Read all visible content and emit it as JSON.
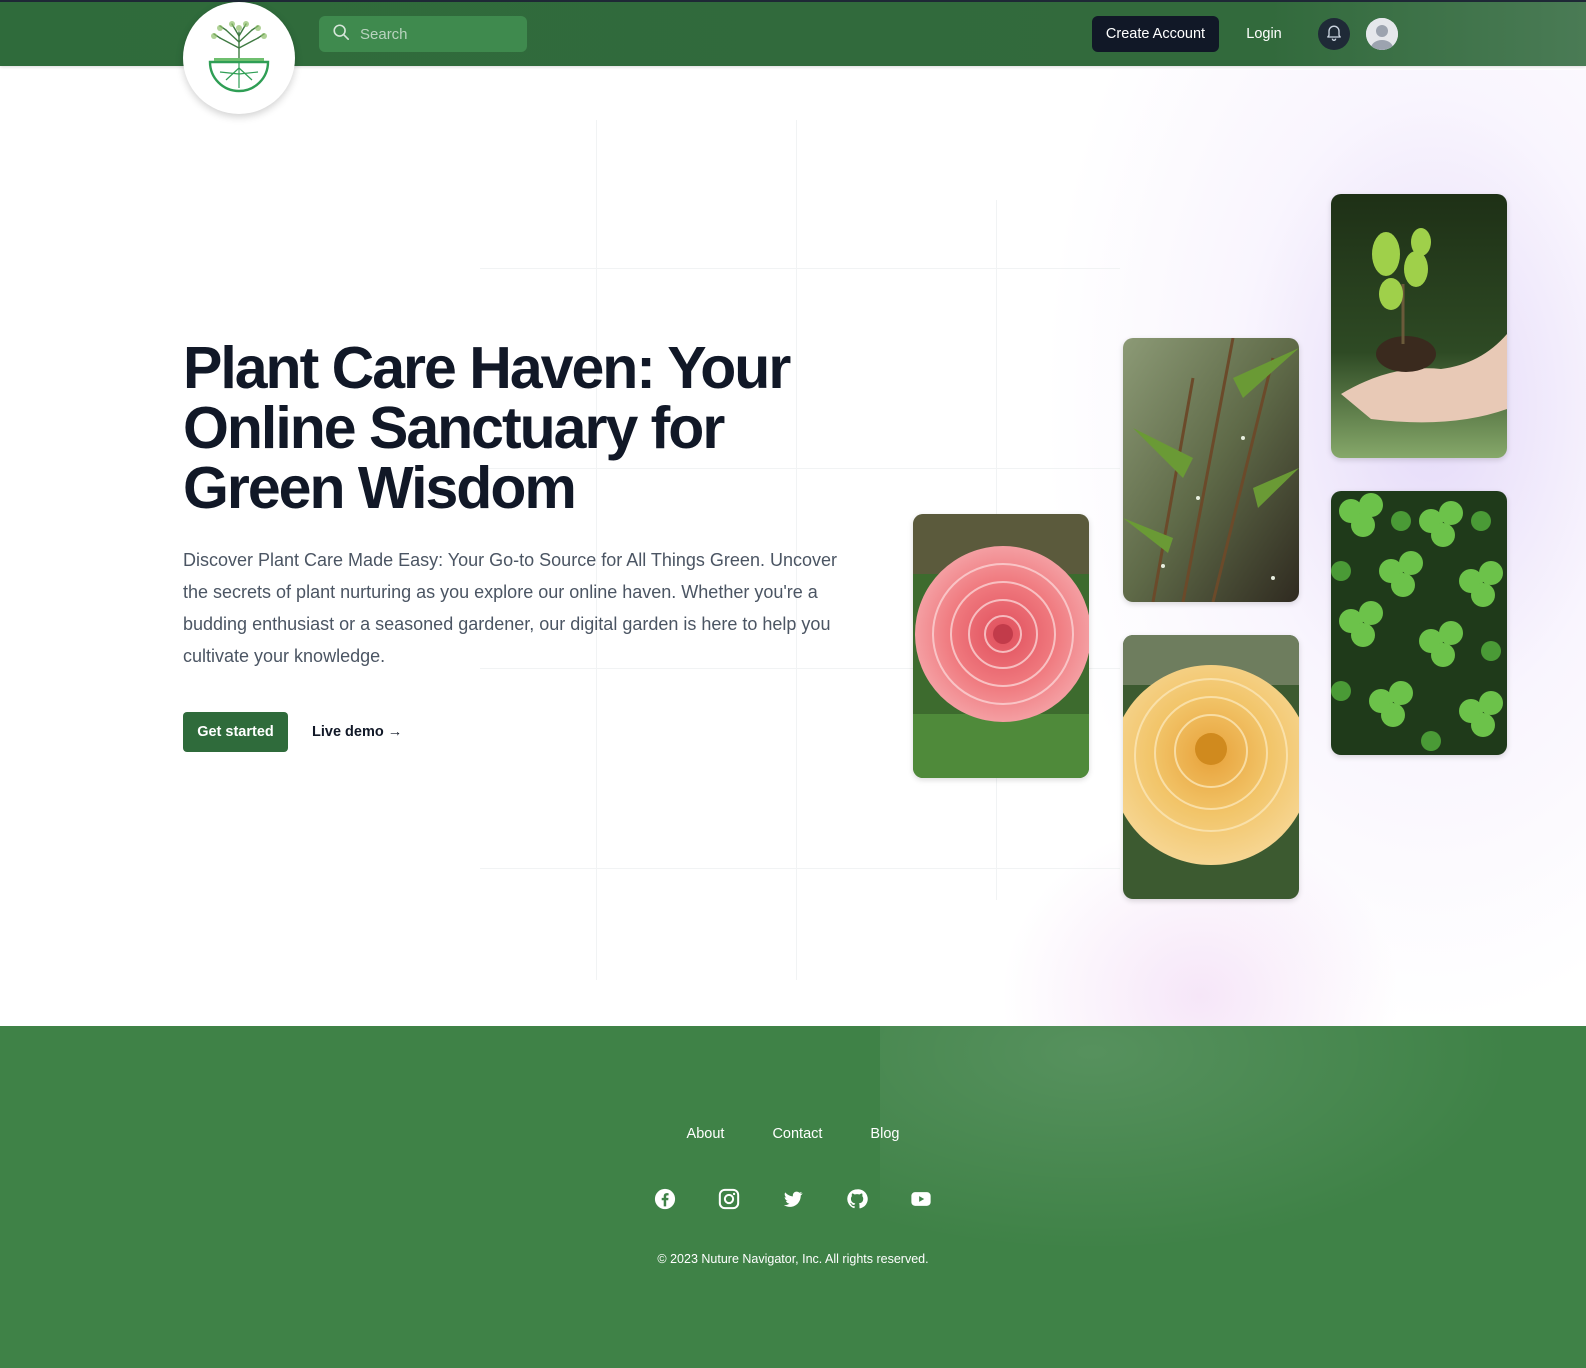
{
  "header": {
    "search_placeholder": "Search",
    "create_account": "Create Account",
    "login": "Login"
  },
  "hero": {
    "title": "Plant Care Haven: Your Online Sanctuary for Green Wisdom",
    "description": "Discover Plant Care Made Easy: Your Go-to Source for All Things Green. Uncover the secrets of plant nurturing as you explore our online haven. Whether you're a budding enthusiast or a seasoned gardener, our digital garden is here to help you cultivate your knowledge.",
    "primary_cta": "Get started",
    "secondary_cta": "Live demo →"
  },
  "gallery": [
    {
      "name": "pink-dahlia-photo"
    },
    {
      "name": "green-stems-photo"
    },
    {
      "name": "yellow-dahlia-photo"
    },
    {
      "name": "seedling-in-hand-photo"
    },
    {
      "name": "clover-photo"
    }
  ],
  "footer": {
    "links": [
      "About",
      "Contact",
      "Blog"
    ],
    "social_icons": [
      "facebook-icon",
      "instagram-icon",
      "twitter-icon",
      "github-icon",
      "youtube-icon"
    ],
    "copyright": "© 2023 Nuture Navigator, Inc. All rights reserved."
  },
  "colors": {
    "header_green": "#2f6b3b",
    "footer_green": "#3f8247",
    "dark": "#111827"
  }
}
